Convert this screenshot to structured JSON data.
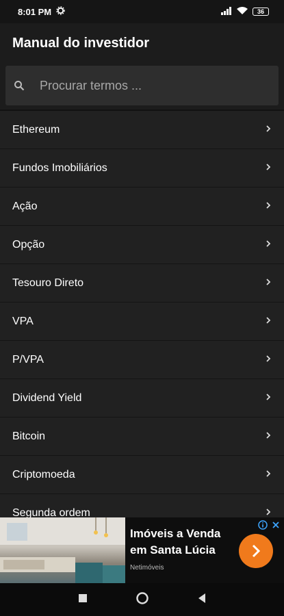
{
  "status_bar": {
    "time": "8:01 PM",
    "battery": "36"
  },
  "app_bar": {
    "title": "Manual do investidor"
  },
  "search": {
    "placeholder": "Procurar termos ..."
  },
  "list": {
    "items": [
      {
        "label": "Ethereum"
      },
      {
        "label": "Fundos Imobiliários"
      },
      {
        "label": "Ação"
      },
      {
        "label": "Opção"
      },
      {
        "label": "Tesouro Direto"
      },
      {
        "label": "VPA"
      },
      {
        "label": "P/VPA"
      },
      {
        "label": "Dividend Yield"
      },
      {
        "label": "Bitcoin"
      },
      {
        "label": "Criptomoeda"
      },
      {
        "label": "Segunda ordem"
      }
    ]
  },
  "ad": {
    "title": "Imóveis a Venda em Santa Lúcia",
    "source": "Netimóveis",
    "cta_color": "#f07a1c"
  },
  "colors": {
    "background": "#121212",
    "list_item": "#212121",
    "app_bar": "#1c1c1c"
  }
}
